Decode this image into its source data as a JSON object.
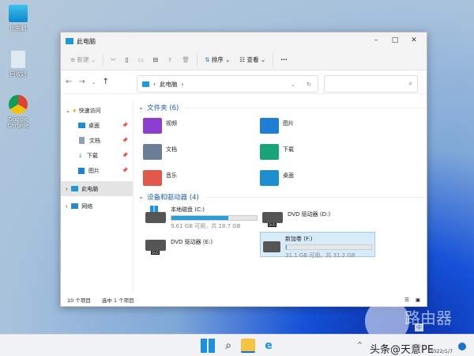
{
  "desktop": {
    "icons": [
      {
        "label": "此电脑"
      },
      {
        "label": "回收站"
      },
      {
        "label": "Google Chrome"
      }
    ]
  },
  "window": {
    "title": "此电脑",
    "minimize": "–",
    "maximize": "□",
    "close": "✕"
  },
  "toolbar": {
    "new_label": "新建",
    "sort_label": "排序",
    "view_label": "查看",
    "more": "···"
  },
  "address": {
    "path": "此电脑",
    "chevron": "›"
  },
  "nav": {
    "items": [
      {
        "label": "快速访问"
      },
      {
        "label": "桌面"
      },
      {
        "label": "文档"
      },
      {
        "label": "下载"
      },
      {
        "label": "图片"
      },
      {
        "label": "此电脑"
      },
      {
        "label": "网络"
      }
    ]
  },
  "main": {
    "folders_header": "文件夹 (6)",
    "folders": [
      {
        "label": "视频",
        "color": "#8a3fd1"
      },
      {
        "label": "图片",
        "color": "#1f7fd6"
      },
      {
        "label": "文档",
        "color": "#6a7f95"
      },
      {
        "label": "下载",
        "color": "#1aa37a"
      },
      {
        "label": "音乐",
        "color": "#e2584a"
      },
      {
        "label": "桌面",
        "color": "#1b8fd0"
      }
    ],
    "drives_header": "设备和驱动器 (4)",
    "drives": [
      {
        "label": "本地磁盘 (C:)",
        "free": "9.61 GB 可用，共 28.7 GB",
        "used_pct": 66.5
      },
      {
        "label": "DVD 驱动器 (D:)"
      },
      {
        "label": "DVD 驱动器 (E:)"
      },
      {
        "label": "新加卷 (F:)",
        "free": "31.1 GB 可用，共 31.2 GB",
        "used_pct": 0.3
      }
    ],
    "dvd_tag": "DVD"
  },
  "status": {
    "count": "10 个项目",
    "selected": "选中 1 个项目"
  },
  "taskbar": {
    "date": "2022/1/7",
    "ime": "中"
  },
  "watermark": {
    "logo": "路由器",
    "credit": "头条@天意PE"
  }
}
